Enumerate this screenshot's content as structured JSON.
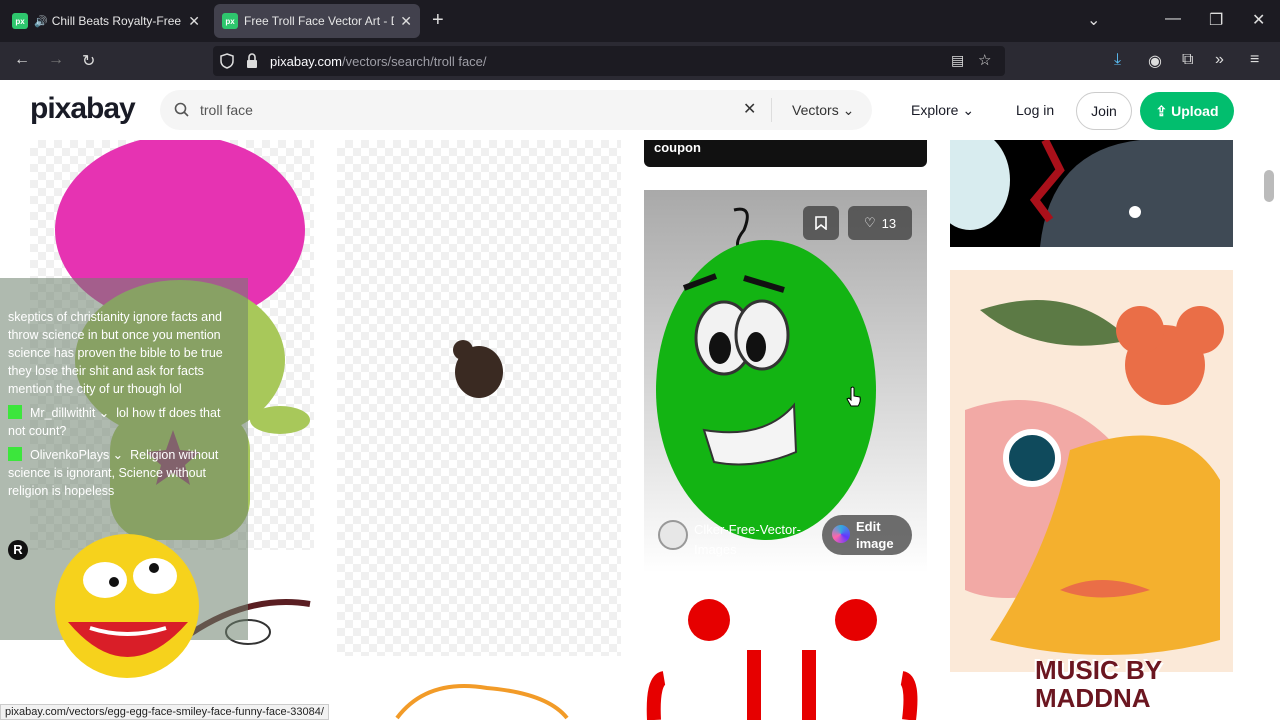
{
  "browser": {
    "tabs": [
      {
        "label": "Chill Beats Royalty-Free Rad",
        "favicon": "px"
      },
      {
        "label": "Free Troll Face Vector Art - Dow",
        "favicon": "px"
      }
    ],
    "url_host": "pixabay.com",
    "url_path": "/vectors/search/troll face/"
  },
  "site": {
    "logo": "pixabay",
    "search_value": "troll face",
    "search_type": "Vectors",
    "nav": {
      "explore": "Explore",
      "login": "Log in",
      "join": "Join",
      "upload": "Upload"
    },
    "accent": "#02be6e"
  },
  "results": {
    "coupon_text": "coupon",
    "featured": {
      "likes": "13",
      "author": "Clker-Free-Vector-Images",
      "edit_label": "Edit image"
    }
  },
  "chat": {
    "messages": [
      {
        "user": "",
        "text": "skeptics of christianity ignore facts and throw science in but once you mention science has proven the bible to be true they lose their shit and ask for facts mention the city of ur though lol"
      },
      {
        "user": "Mr_dillwithit",
        "text": "lol how tf does that not count?"
      },
      {
        "user": "OlivenkoPlays",
        "text": "Religion without science is ignorant, Science without religion is hopeless"
      }
    ],
    "input_initial": "R"
  },
  "status_url": "pixabay.com/vectors/egg-egg-face-smiley-face-funny-face-33084/",
  "watermark": "MUSIC BY MADDNA"
}
